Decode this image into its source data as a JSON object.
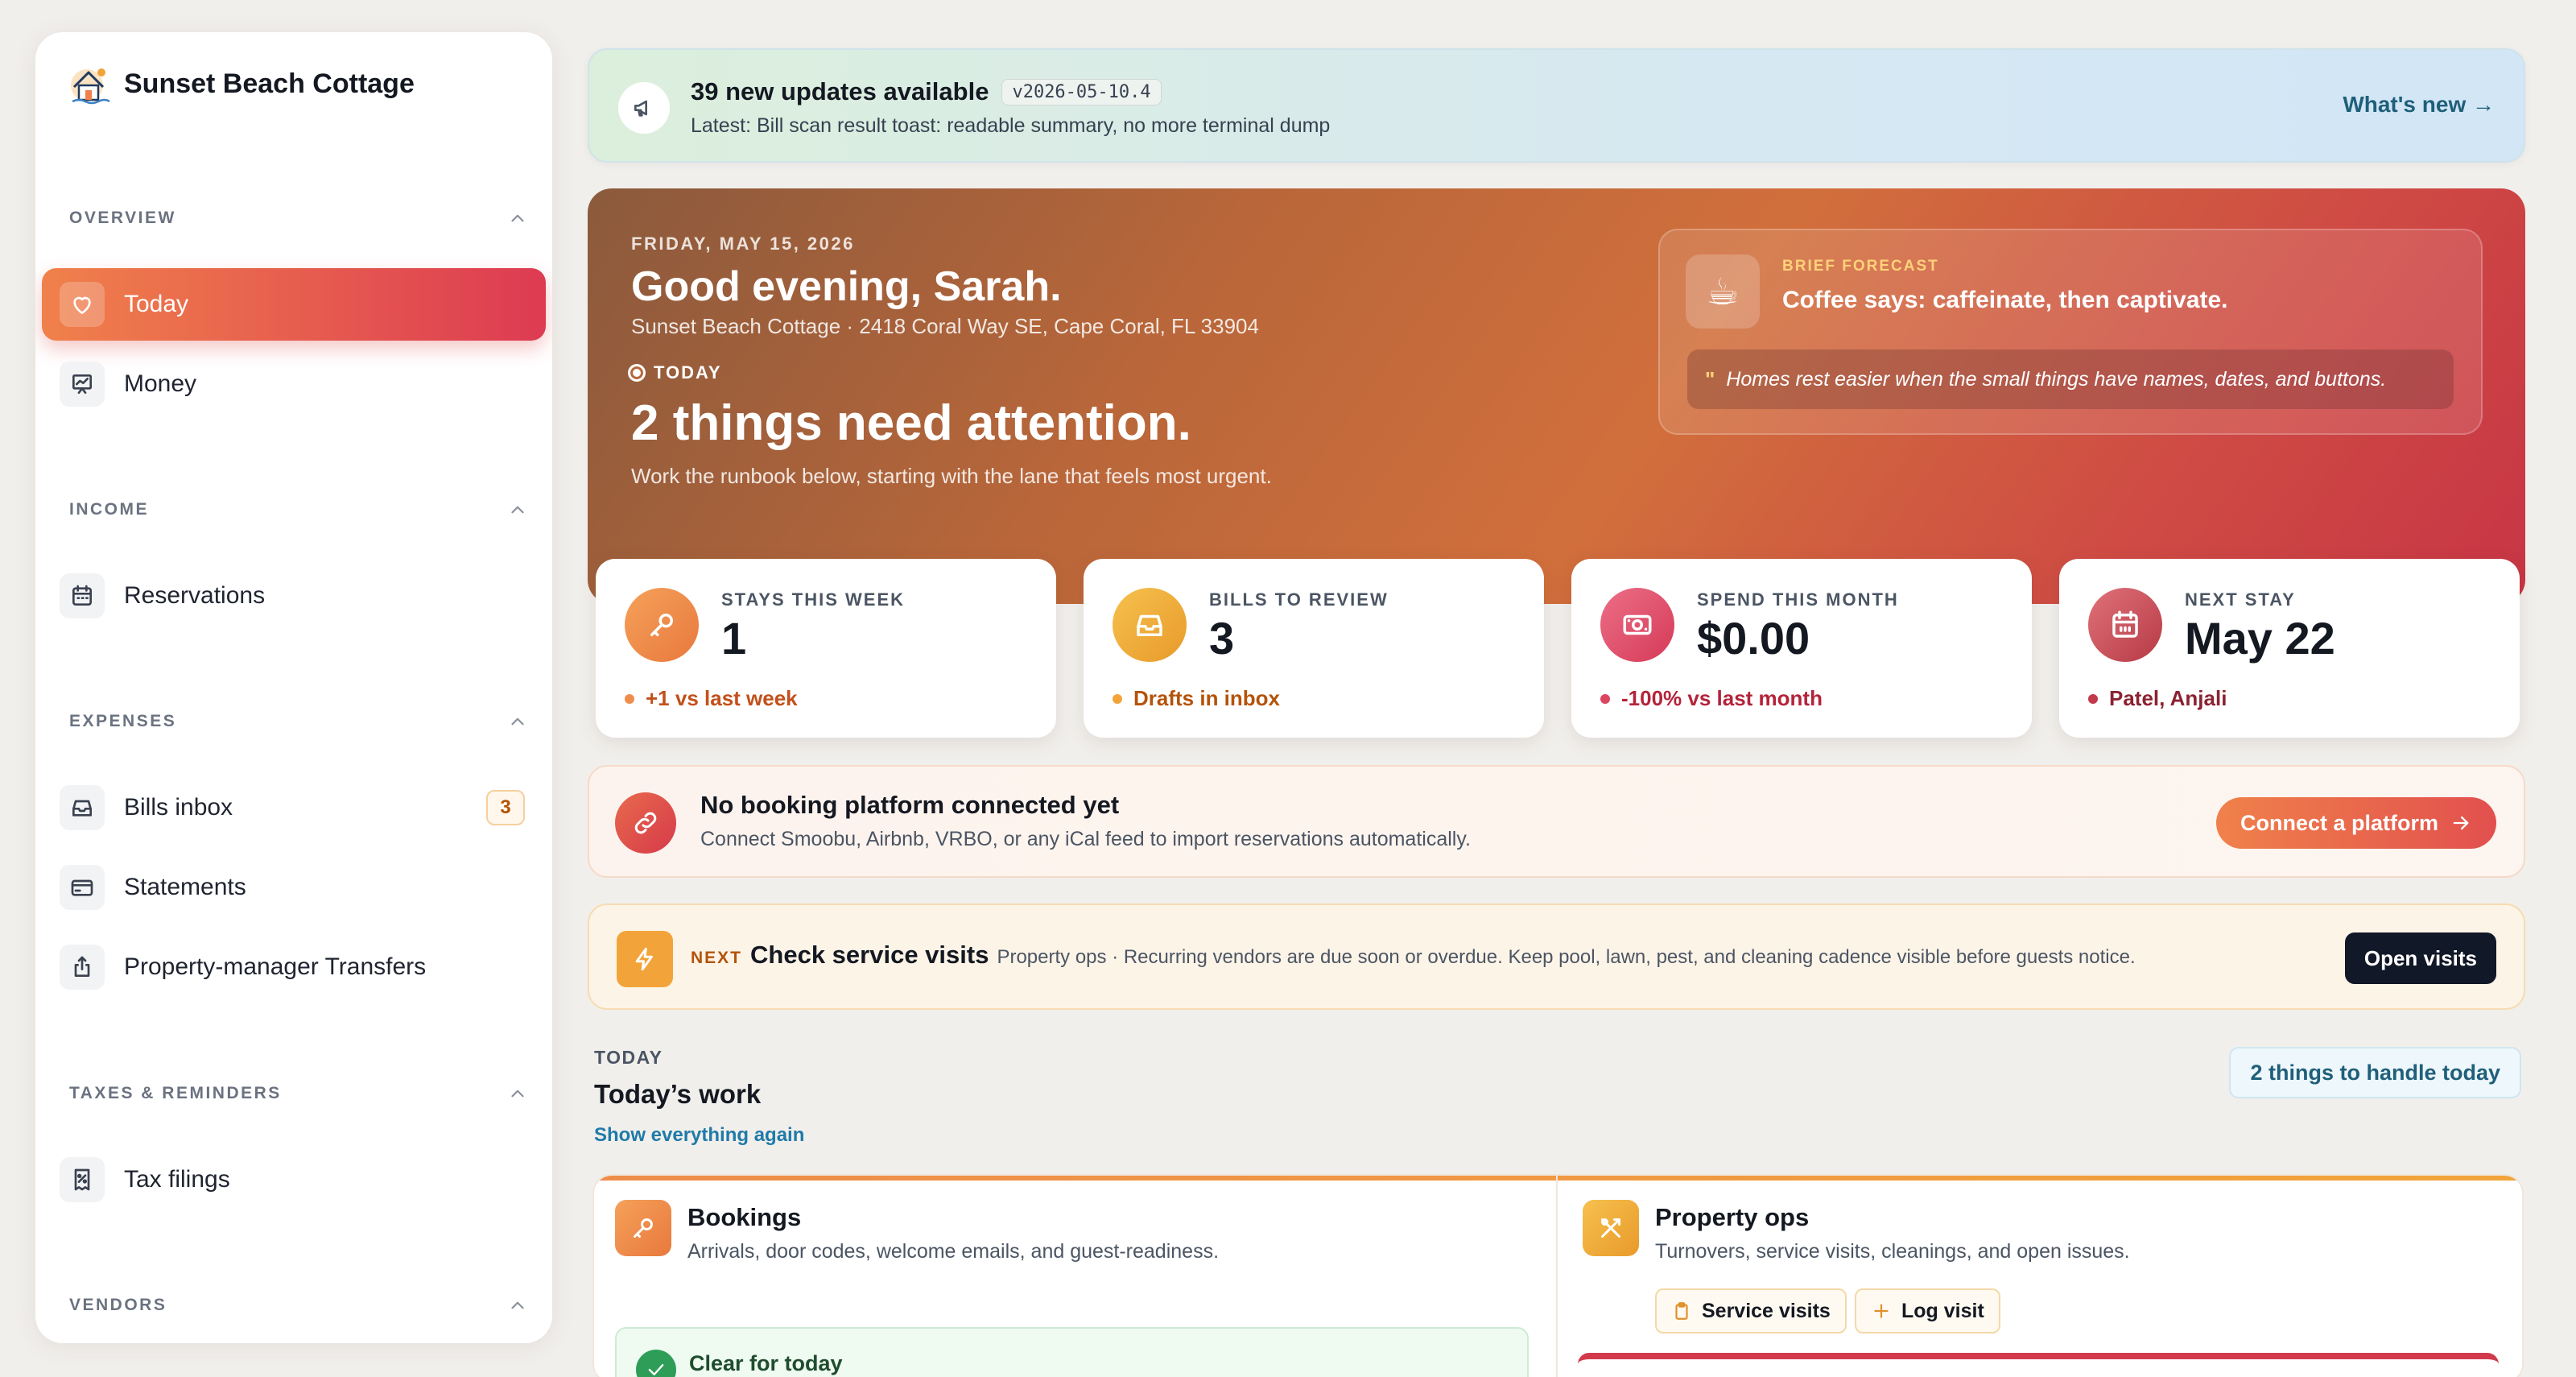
{
  "sidebar": {
    "brand": "Sunset Beach Cottage",
    "sections": {
      "overview": "OVERVIEW",
      "income": "INCOME",
      "expenses": "EXPENSES",
      "taxes": "TAXES & REMINDERS",
      "vendors": "VENDORS"
    },
    "items": {
      "today": "Today",
      "money": "Money",
      "reservations": "Reservations",
      "bills": "Bills inbox",
      "bills_count": "3",
      "statements": "Statements",
      "transfers": "Property-manager Transfers",
      "tax": "Tax filings"
    }
  },
  "update": {
    "title": "39 new updates available",
    "version": "v2026-05-10.4",
    "subtitle": "Latest: Bill scan result toast: readable summary, no more terminal dump",
    "link": "What's new →"
  },
  "hero": {
    "date": "FRIDAY, MAY 15, 2026",
    "greeting": "Good evening, Sarah.",
    "address": "Sunset Beach Cottage · 2418 Coral Way SE, Cape Coral, FL 33904",
    "today_label": "TODAY",
    "headline": "2 things need attention.",
    "subline": "Work the runbook below, starting with the lane that feels most urgent.",
    "forecast": {
      "label": "BRIEF FORECAST",
      "line": "Coffee says: caffeinate, then captivate.",
      "quote": "Homes rest easier when the small things have names, dates, and buttons."
    }
  },
  "stats": [
    {
      "label": "STAYS THIS WEEK",
      "value": "1",
      "foot": "+1 vs last week",
      "color": "#c2501a",
      "icon": "key-icon"
    },
    {
      "label": "BILLS TO REVIEW",
      "value": "3",
      "foot": "Drafts in inbox",
      "color": "#b45309",
      "icon": "inbox-icon"
    },
    {
      "label": "SPEND THIS MONTH",
      "value": "$0.00",
      "foot": "-100% vs last month",
      "color": "#b4233a",
      "icon": "money-icon"
    },
    {
      "label": "NEXT STAY",
      "value": "May 22",
      "foot": "Patel, Anjali",
      "color": "#8b2232",
      "icon": "calendar-icon"
    }
  ],
  "connect": {
    "title": "No booking platform connected yet",
    "subtitle": "Connect Smoobu, Airbnb, VRBO, or any iCal feed to import reservations automatically.",
    "button": "Connect a platform"
  },
  "next": {
    "label": "NEXT",
    "title": "Check service visits",
    "subtitle": "Property ops · Recurring vendors are due soon or overdue. Keep pool, lawn, pest, and cleaning cadence visible before guests notice.",
    "button": "Open visits"
  },
  "today": {
    "section": "TODAY",
    "title": "Today’s work",
    "show_all": "Show everything again",
    "badge": "2 things to handle today"
  },
  "lanes": {
    "bookings": {
      "title": "Bookings",
      "subtitle": "Arrivals, door codes, welcome emails, and guest-readiness.",
      "clear": "Clear for today"
    },
    "ops": {
      "title": "Property ops",
      "subtitle": "Turnovers, service visits, cleanings, and open issues.",
      "chip_visits": "Service visits",
      "chip_log": "Log visit"
    }
  },
  "colors": {
    "accent": "#e2504e",
    "warm": "#f2a43a",
    "dark": "#111827"
  }
}
